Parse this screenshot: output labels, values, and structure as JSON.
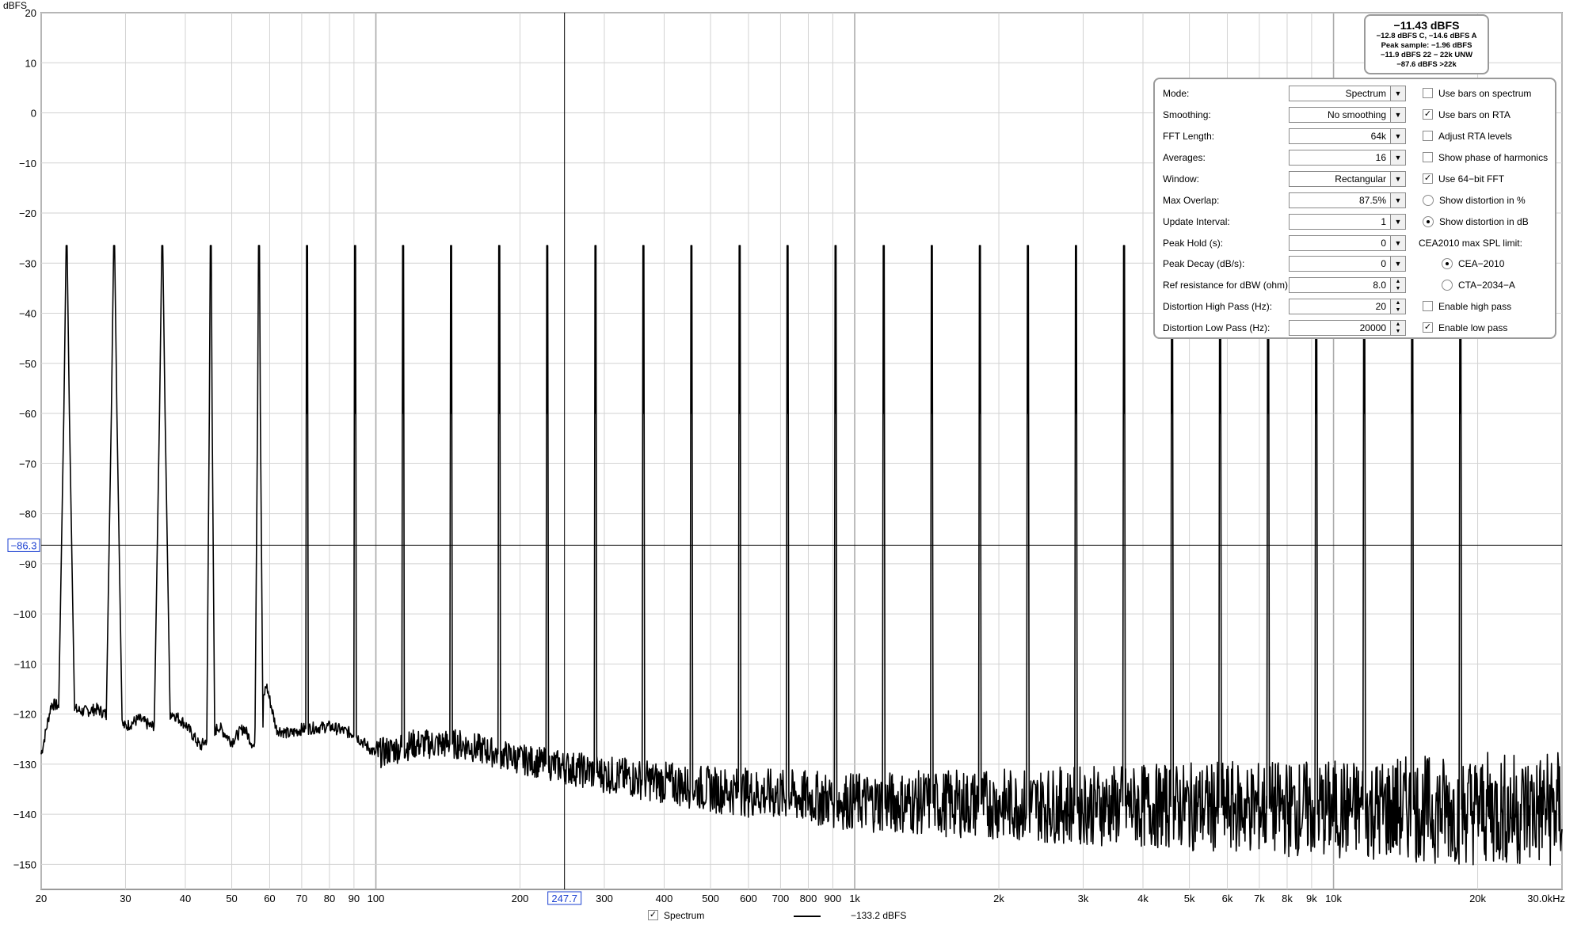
{
  "readout": {
    "level": "−11.43 dBFS",
    "lines": [
      "−12.8 dBFS C, −14.6 dBFS A",
      "Peak sample: −1.96 dBFS",
      "−11.9 dBFS 22 − 22k UNW",
      "−87.6 dBFS >22k"
    ]
  },
  "controls": {
    "mode": {
      "label": "Mode:",
      "value": "Spectrum"
    },
    "smoothing": {
      "label": "Smoothing:",
      "value": "No  smoothing"
    },
    "fft_length": {
      "label": "FFT Length:",
      "value": "64k"
    },
    "averages": {
      "label": "Averages:",
      "value": "16"
    },
    "window": {
      "label": "Window:",
      "value": "Rectangular"
    },
    "max_overlap": {
      "label": "Max Overlap:",
      "value": "87.5%"
    },
    "update_interval": {
      "label": "Update Interval:",
      "value": "1"
    },
    "peak_hold": {
      "label": "Peak Hold (s):",
      "value": "0"
    },
    "peak_decay": {
      "label": "Peak Decay (dB/s):",
      "value": "0"
    },
    "ref_resistance": {
      "label": "Ref resistance for dBW (ohm):",
      "value": "8.0"
    },
    "dist_high_pass": {
      "label": "Distortion High Pass (Hz):",
      "value": "20"
    },
    "dist_low_pass": {
      "label": "Distortion Low Pass (Hz):",
      "value": "20000"
    }
  },
  "options": {
    "bars_spectrum": {
      "label": "Use bars on spectrum",
      "checked": false
    },
    "bars_rta": {
      "label": "Use bars on RTA",
      "checked": true
    },
    "adjust_rta": {
      "label": "Adjust RTA levels",
      "checked": false
    },
    "show_phase": {
      "label": "Show phase of harmonics",
      "checked": false
    },
    "use_64bit": {
      "label": "Use 64−bit FFT",
      "checked": true
    },
    "dist_percent": {
      "label": "Show distortion in %",
      "selected": false
    },
    "dist_db": {
      "label": "Show distortion in dB",
      "selected": true
    },
    "cea_limit_label": "CEA2010 max SPL limit:",
    "cea2010": {
      "label": "CEA−2010",
      "selected": true
    },
    "cta2034": {
      "label": "CTA−2034−A",
      "selected": false
    },
    "enable_high_pass": {
      "label": "Enable high pass",
      "checked": false
    },
    "enable_low_pass": {
      "label": "Enable low pass",
      "checked": true
    }
  },
  "legend": {
    "series_name": "Spectrum",
    "series_checked": true,
    "cursor_value": "−133.2 dBFS"
  },
  "cursor": {
    "x_label": "247.7",
    "y_label": "−86.3",
    "freq": 247.7,
    "db": -86.3
  },
  "colors": {
    "trace": "#000000",
    "grid": "#d2d2d2",
    "grid_major": "#aaaaaa",
    "cursor_label": "#1a3fd1"
  },
  "chart_data": {
    "type": "line",
    "ylabel": "dBFS",
    "xscale": "log",
    "xlim": [
      20,
      30000
    ],
    "ylim": [
      -155,
      20
    ],
    "grid": true,
    "y_ticks": [
      "20",
      "10",
      "0",
      "−10",
      "−20",
      "−30",
      "−40",
      "−50",
      "−60",
      "−70",
      "−80",
      "−90",
      "−100",
      "−110",
      "−120",
      "−130",
      "−140",
      "−150"
    ],
    "x_ticks": [
      {
        "v": 20,
        "t": "20"
      },
      {
        "v": 30,
        "t": "30"
      },
      {
        "v": 40,
        "t": "40"
      },
      {
        "v": 50,
        "t": "50"
      },
      {
        "v": 60,
        "t": "60"
      },
      {
        "v": 70,
        "t": "70"
      },
      {
        "v": 80,
        "t": "80"
      },
      {
        "v": 90,
        "t": "90"
      },
      {
        "v": 100,
        "t": "100"
      },
      {
        "v": 200,
        "t": "200"
      },
      {
        "v": 300,
        "t": "300"
      },
      {
        "v": 400,
        "t": "400"
      },
      {
        "v": 500,
        "t": "500"
      },
      {
        "v": 600,
        "t": "600"
      },
      {
        "v": 700,
        "t": "700"
      },
      {
        "v": 800,
        "t": "800"
      },
      {
        "v": 900,
        "t": "900"
      },
      {
        "v": 1000,
        "t": "1k"
      },
      {
        "v": 2000,
        "t": "2k"
      },
      {
        "v": 3000,
        "t": "3k"
      },
      {
        "v": 4000,
        "t": "4k"
      },
      {
        "v": 5000,
        "t": "5k"
      },
      {
        "v": 6000,
        "t": "6k"
      },
      {
        "v": 7000,
        "t": "7k"
      },
      {
        "v": 8000,
        "t": "8k"
      },
      {
        "v": 9000,
        "t": "9k"
      },
      {
        "v": 10000,
        "t": "10k"
      },
      {
        "v": 20000,
        "t": "20k"
      },
      {
        "v": 30000,
        "t": "30.0kHz"
      }
    ],
    "series": [
      {
        "peak_db": -26.5,
        "peak_freqs": [
          22.6,
          28.4,
          35.8,
          45.2,
          57.0,
          71.8,
          90.5,
          114.0,
          143.6,
          181.0,
          228.0,
          287.5,
          362.0,
          456.0,
          575.0,
          724.0,
          912.0,
          1150.0,
          1449.0,
          1826.0,
          2300.0,
          2898.0,
          3652.0,
          4600.0,
          5796.0,
          7302.0,
          9200.0,
          11590.0,
          14600.0,
          18400.0
        ],
        "noise_floor": [
          [
            20,
            -128
          ],
          [
            21,
            -118
          ],
          [
            24.5,
            -119.5
          ],
          [
            26.2,
            -119
          ],
          [
            30,
            -122.5
          ],
          [
            32,
            -121
          ],
          [
            34,
            -122.5
          ],
          [
            37.5,
            -119.7
          ],
          [
            40,
            -122
          ],
          [
            43,
            -126.5
          ],
          [
            47,
            -122.5
          ],
          [
            50,
            -125.5
          ],
          [
            53,
            -122.7
          ],
          [
            56,
            -127
          ],
          [
            59,
            -114
          ],
          [
            62,
            -123
          ],
          [
            66,
            -124
          ],
          [
            70,
            -123
          ],
          [
            80,
            -122.5
          ],
          [
            90,
            -124
          ],
          [
            100,
            -128
          ],
          [
            120,
            -126
          ],
          [
            150,
            -126
          ],
          [
            200,
            -129
          ],
          [
            300,
            -132
          ],
          [
            500,
            -135
          ],
          [
            1000,
            -137.5
          ],
          [
            2000,
            -138
          ],
          [
            5000,
            -138.5
          ],
          [
            10000,
            -139
          ],
          [
            20000,
            -139
          ],
          [
            30000,
            -139
          ]
        ]
      }
    ]
  }
}
